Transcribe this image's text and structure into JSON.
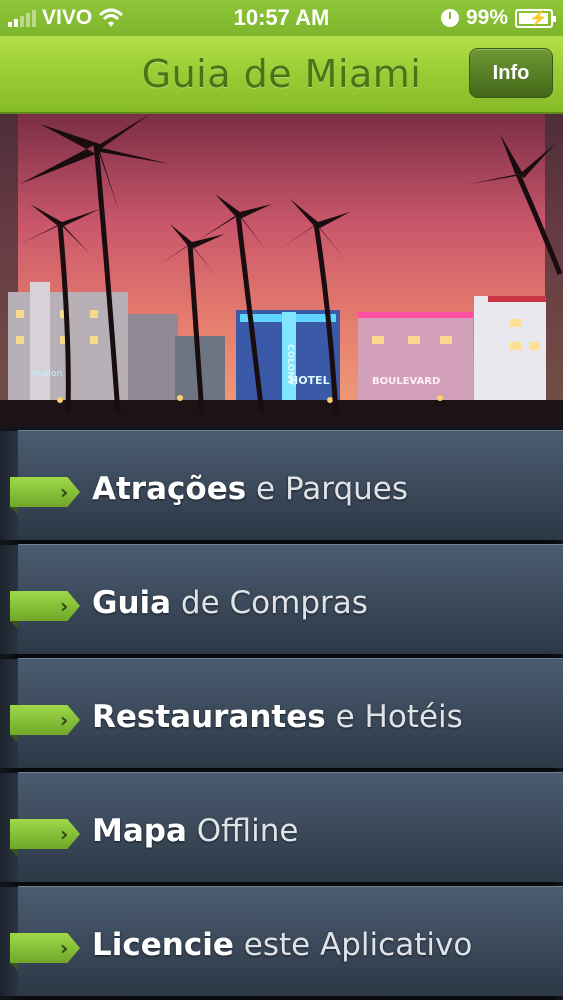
{
  "status_bar": {
    "carrier": "VIVO",
    "time": "10:57 AM",
    "battery": "99%"
  },
  "nav": {
    "title": "Guia de Miami",
    "info_label": "Info"
  },
  "banner": {
    "neon_signs": [
      "COLONY",
      "HOTEL",
      "BOULEVARD",
      "Avalon"
    ]
  },
  "menu": [
    {
      "strong": "Atrações",
      "light": " e Parques"
    },
    {
      "strong": "Guia",
      "light": " de Compras"
    },
    {
      "strong": "Restaurantes",
      "light": " e Hotéis"
    },
    {
      "strong": "Mapa",
      "light": " Offline"
    },
    {
      "strong": "Licencie",
      "light": " este Aplicativo"
    }
  ],
  "colors": {
    "accent_green": "#8fc63a",
    "title_green": "#4b7418",
    "menu_blue": "#3a4859"
  },
  "icons": [
    "signal-icon",
    "wifi-icon",
    "clock-icon",
    "battery-icon",
    "chevron-right-icon"
  ]
}
